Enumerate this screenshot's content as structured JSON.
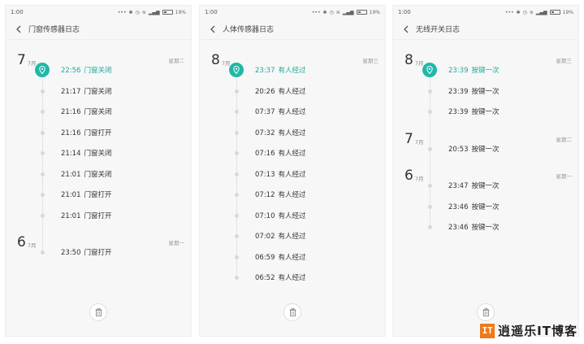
{
  "accent_color": "#20b8a8",
  "screens": [
    {
      "status": {
        "time": "1:00",
        "battery": "19%"
      },
      "title": "门窗传感器日志",
      "groups": [
        {
          "day": "7",
          "month": "7月",
          "weekday": "星期二",
          "entries": [
            {
              "time": "22:56",
              "event": "门窗关闭",
              "active": true
            },
            {
              "time": "21:17",
              "event": "门窗关闭"
            },
            {
              "time": "21:16",
              "event": "门窗关闭"
            },
            {
              "time": "21:16",
              "event": "门窗打开"
            },
            {
              "time": "21:14",
              "event": "门窗关闭"
            },
            {
              "time": "21:01",
              "event": "门窗关闭"
            },
            {
              "time": "21:01",
              "event": "门窗打开"
            },
            {
              "time": "21:01",
              "event": "门窗打开"
            }
          ]
        },
        {
          "day": "6",
          "month": "7月",
          "weekday": "星期一",
          "entries": [
            {
              "time": "23:50",
              "event": "门窗打开"
            }
          ]
        }
      ]
    },
    {
      "status": {
        "time": "1:00",
        "battery": "19%"
      },
      "title": "人体传感器日志",
      "groups": [
        {
          "day": "8",
          "month": "7月",
          "weekday": "星期三",
          "entries": [
            {
              "time": "23:37",
              "event": "有人经过",
              "active": true
            },
            {
              "time": "20:26",
              "event": "有人经过"
            },
            {
              "time": "07:37",
              "event": "有人经过"
            },
            {
              "time": "07:32",
              "event": "有人经过"
            },
            {
              "time": "07:16",
              "event": "有人经过"
            },
            {
              "time": "07:13",
              "event": "有人经过"
            },
            {
              "time": "07:12",
              "event": "有人经过"
            },
            {
              "time": "07:10",
              "event": "有人经过"
            },
            {
              "time": "07:02",
              "event": "有人经过"
            },
            {
              "time": "06:59",
              "event": "有人经过"
            },
            {
              "time": "06:52",
              "event": "有人经过"
            }
          ]
        }
      ]
    },
    {
      "status": {
        "time": "1:00",
        "battery": "19%"
      },
      "title": "无线开关日志",
      "groups": [
        {
          "day": "8",
          "month": "7月",
          "weekday": "星期三",
          "entries": [
            {
              "time": "23:39",
              "event": "按键一次",
              "active": true
            },
            {
              "time": "23:39",
              "event": "按键一次"
            },
            {
              "time": "23:39",
              "event": "按键一次"
            }
          ]
        },
        {
          "day": "7",
          "month": "7月",
          "weekday": "星期二",
          "entries": [
            {
              "time": "20:53",
              "event": "按键一次"
            }
          ]
        },
        {
          "day": "6",
          "month": "7月",
          "weekday": "星期一",
          "entries": [
            {
              "time": "23:47",
              "event": "按键一次"
            },
            {
              "time": "23:46",
              "event": "按键一次"
            },
            {
              "time": "23:46",
              "event": "按键一次"
            }
          ]
        }
      ]
    }
  ],
  "watermark": {
    "mark": "IT",
    "text": "逍遥乐IT博客"
  }
}
